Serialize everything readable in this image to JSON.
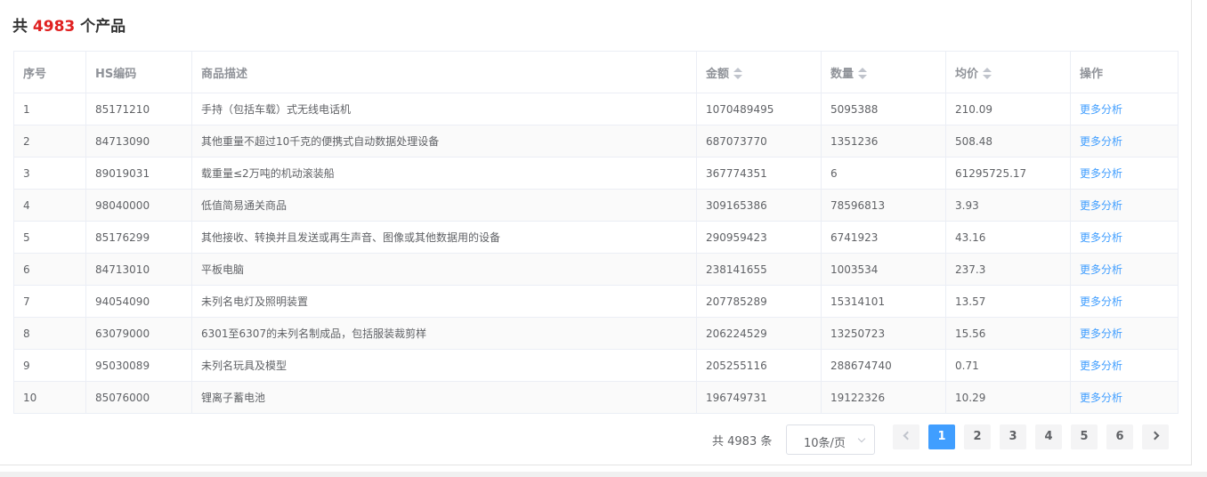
{
  "header": {
    "prefix": "共",
    "count": "4983",
    "suffix": "个产品"
  },
  "table": {
    "columns": {
      "index": "序号",
      "hs_code": "HS编码",
      "description": "商品描述",
      "amount": "金额",
      "quantity": "数量",
      "avg_price": "均价",
      "action": "操作"
    },
    "rows": [
      {
        "index": "1",
        "hs_code": "85171210",
        "description": "手持（包括车载）式无线电话机",
        "amount": "1070489495",
        "quantity": "5095388",
        "avg_price": "210.09",
        "action": "更多分析"
      },
      {
        "index": "2",
        "hs_code": "84713090",
        "description": "其他重量不超过10千克的便携式自动数据处理设备",
        "amount": "687073770",
        "quantity": "1351236",
        "avg_price": "508.48",
        "action": "更多分析"
      },
      {
        "index": "3",
        "hs_code": "89019031",
        "description": "载重量≤2万吨的机动滚装船",
        "amount": "367774351",
        "quantity": "6",
        "avg_price": "61295725.17",
        "action": "更多分析"
      },
      {
        "index": "4",
        "hs_code": "98040000",
        "description": "低值简易通关商品",
        "amount": "309165386",
        "quantity": "78596813",
        "avg_price": "3.93",
        "action": "更多分析"
      },
      {
        "index": "5",
        "hs_code": "85176299",
        "description": "其他接收、转换并且发送或再生声音、图像或其他数据用的设备",
        "amount": "290959423",
        "quantity": "6741923",
        "avg_price": "43.16",
        "action": "更多分析"
      },
      {
        "index": "6",
        "hs_code": "84713010",
        "description": "平板电脑",
        "amount": "238141655",
        "quantity": "1003534",
        "avg_price": "237.3",
        "action": "更多分析"
      },
      {
        "index": "7",
        "hs_code": "94054090",
        "description": "未列名电灯及照明装置",
        "amount": "207785289",
        "quantity": "15314101",
        "avg_price": "13.57",
        "action": "更多分析"
      },
      {
        "index": "8",
        "hs_code": "63079000",
        "description": "6301至6307的未列名制成品，包括服装裁剪样",
        "amount": "206224529",
        "quantity": "13250723",
        "avg_price": "15.56",
        "action": "更多分析"
      },
      {
        "index": "9",
        "hs_code": "95030089",
        "description": "未列名玩具及模型",
        "amount": "205255116",
        "quantity": "288674740",
        "avg_price": "0.71",
        "action": "更多分析"
      },
      {
        "index": "10",
        "hs_code": "85076000",
        "description": "锂离子蓄电池",
        "amount": "196749731",
        "quantity": "19122326",
        "avg_price": "10.29",
        "action": "更多分析"
      }
    ]
  },
  "pagination": {
    "total": "共 4983 条",
    "page_size": "10条/页",
    "pages": [
      "1",
      "2",
      "3",
      "4",
      "5",
      "6"
    ],
    "current_page": "1",
    "icons": {
      "prev": "chevron-left-icon",
      "next": "chevron-right-icon",
      "select": "chevron-down-icon",
      "sort": "sort-caret-icon"
    },
    "accent_color": "#409eff"
  }
}
